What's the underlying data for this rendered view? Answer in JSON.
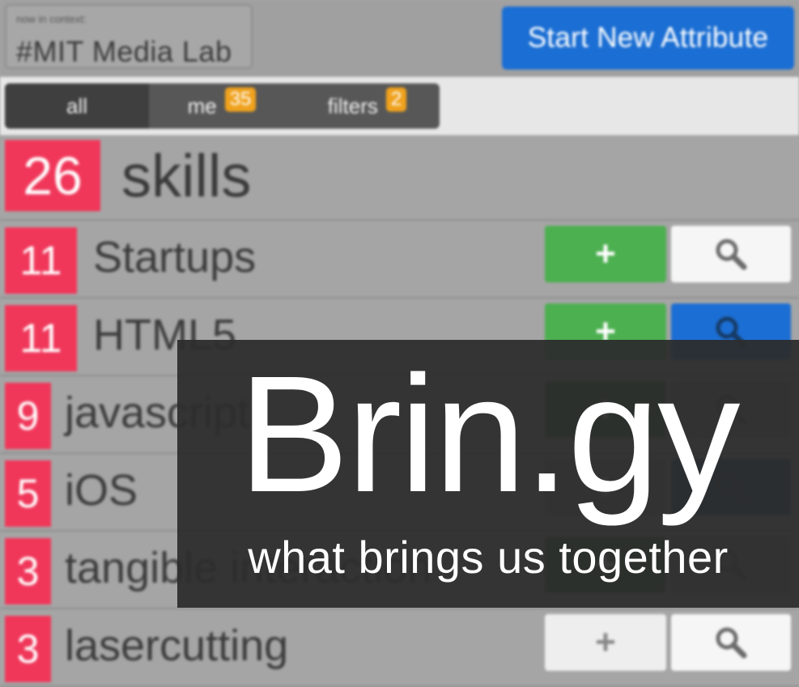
{
  "header": {
    "context_caption": "now in context:",
    "context_name": "#MIT Media Lab",
    "start_button_label": "Start New Attribute"
  },
  "tabs": [
    {
      "label": "all",
      "badge": ""
    },
    {
      "label": "me",
      "badge": "35"
    },
    {
      "label": "filters",
      "badge": "2"
    }
  ],
  "group": {
    "count": "26",
    "title": "skills"
  },
  "rows": [
    {
      "count": "11",
      "label": "Startups",
      "add_label": "+",
      "add_state": "green",
      "search_state": "white"
    },
    {
      "count": "11",
      "label": "HTML5",
      "add_label": "+",
      "add_state": "green",
      "search_state": "blue"
    },
    {
      "count": "9",
      "label": "javascript",
      "add_label": "+",
      "add_state": "dark",
      "search_state": "grey"
    },
    {
      "count": "5",
      "label": "iOS",
      "add_label": "+",
      "add_state": "grey",
      "search_state": "navy"
    },
    {
      "count": "3",
      "label": "tangible interaction",
      "add_label": "+",
      "add_state": "dark",
      "search_state": "grey"
    },
    {
      "count": "3",
      "label": "lasercutting",
      "add_label": "+",
      "add_state": "white",
      "search_state": "white"
    }
  ],
  "brand": {
    "name": "Brin.gy",
    "tagline": "what brings us together"
  },
  "colors": {
    "accent_blue": "#1b6ed3",
    "count_red": "#f0375a",
    "add_green": "#4caf50",
    "badge_orange": "#f0a21d"
  },
  "icons": {
    "add": "plus-icon",
    "search": "magnifier-icon"
  }
}
